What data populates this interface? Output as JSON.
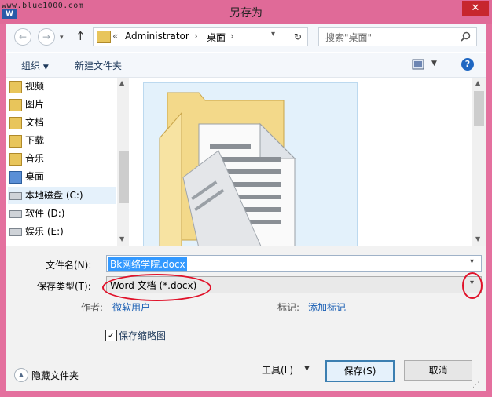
{
  "window": {
    "title": "另存为",
    "watermark": "www.blue1000.com",
    "app_badge": "W",
    "close_glyph": "✕"
  },
  "nav": {
    "back_glyph": "←",
    "forward_glyph": "→",
    "up_glyph": "↑",
    "breadcrumb_sep": "«",
    "breadcrumb": [
      "Administrator",
      "桌面"
    ],
    "refresh_glyph": "↻",
    "search_placeholder": "搜索\"桌面\"",
    "search_icon": "search-icon"
  },
  "toolbar": {
    "organize_label": "组织",
    "new_folder_label": "新建文件夹",
    "help_glyph": "?"
  },
  "sidebar": {
    "items": [
      {
        "label": "视频",
        "icon": "video-folder-icon"
      },
      {
        "label": "图片",
        "icon": "pictures-folder-icon"
      },
      {
        "label": "文档",
        "icon": "documents-folder-icon"
      },
      {
        "label": "下载",
        "icon": "downloads-folder-icon"
      },
      {
        "label": "音乐",
        "icon": "music-folder-icon"
      },
      {
        "label": "桌面",
        "icon": "desktop-folder-icon"
      },
      {
        "label": "本地磁盘 (C:)",
        "icon": "drive-icon"
      },
      {
        "label": "软件 (D:)",
        "icon": "drive-icon"
      },
      {
        "label": "娱乐 (E:)",
        "icon": "drive-icon"
      }
    ]
  },
  "form": {
    "filename_label": "文件名(N):",
    "filename_value": "Bk网络学院.docx",
    "savetype_label": "保存类型(T):",
    "savetype_value": "Word 文档 (*.docx)",
    "author_label": "作者:",
    "author_value": "微软用户",
    "tags_label": "标记:",
    "tags_value": "添加标记",
    "thumbnail_label": "保存缩略图",
    "thumbnail_checked": true
  },
  "footer": {
    "hide_folders_label": "隐藏文件夹",
    "tools_label": "工具(L)",
    "save_label": "保存(S)",
    "cancel_label": "取消"
  },
  "colors": {
    "window_frame": "#e4709e",
    "accent_blue": "#3399ff",
    "annotation_red": "#e0122a"
  }
}
